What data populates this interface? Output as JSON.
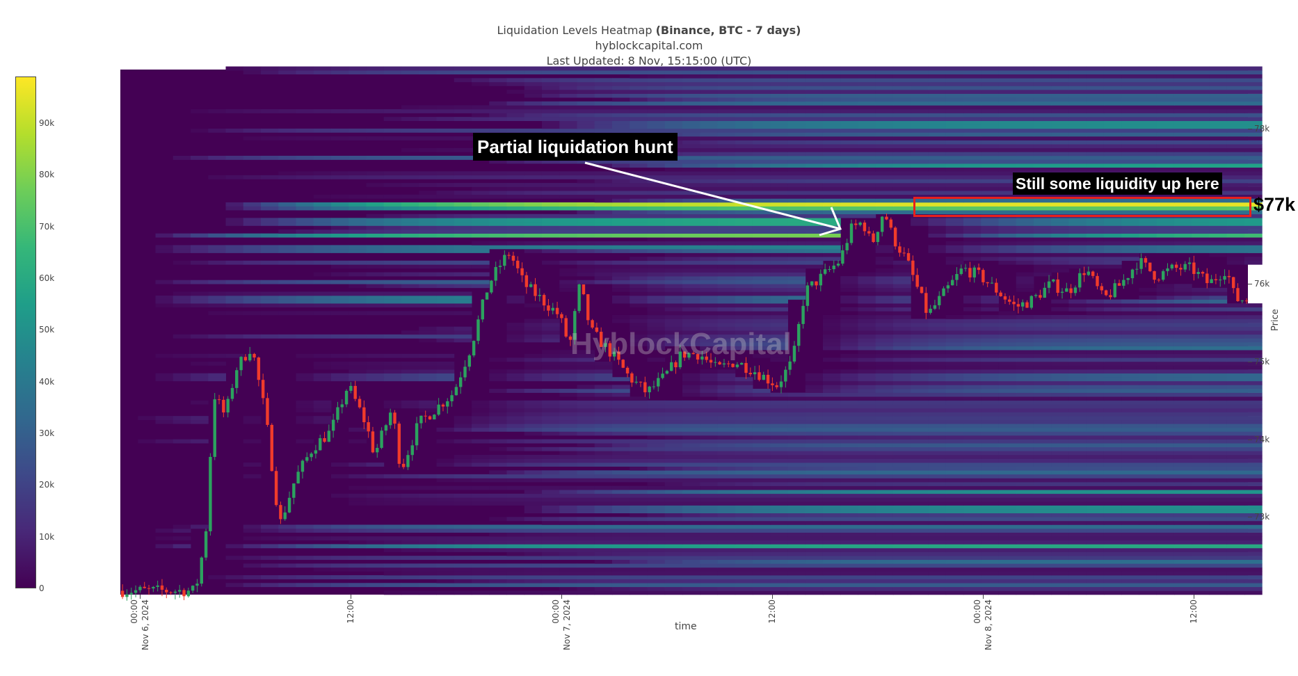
{
  "header": {
    "title_main": "Liquidation Levels Heatmap ",
    "title_bold": "(Binance, BTC - 7 days)",
    "site": "hyblockcapital.com",
    "updated": "Last Updated: 8 Nov, 15:15:00 (UTC)"
  },
  "watermark": "HyblockCapital",
  "annotations": {
    "hunt": "Partial liquidation hunt",
    "liquidity": "Still some liquidity up here",
    "price_label": "$77k"
  },
  "colors": {
    "up": "#2ca25f",
    "down": "#f03b2b",
    "highlight_box": "#e8201c"
  },
  "chart_data": {
    "type": "heatmap",
    "title": "Liquidation Levels Heatmap (Binance, BTC - 7 days)",
    "xlabel": "time",
    "ylabel": "Price",
    "x_unit": "hours since Nov 6, 2024 00:00 UTC",
    "xlim": [
      -1.1,
      63.1
    ],
    "ylim": [
      72000,
      78760
    ],
    "x_ticks": [
      {
        "h": 0,
        "time": "00:00",
        "date": "Nov 6, 2024"
      },
      {
        "h": 12,
        "time": "12:00",
        "date": ""
      },
      {
        "h": 24,
        "time": "00:00",
        "date": "Nov 7, 2024"
      },
      {
        "h": 36,
        "time": "12:00",
        "date": ""
      },
      {
        "h": 48,
        "time": "00:00",
        "date": "Nov 8, 2024"
      },
      {
        "h": 60,
        "time": "12:00",
        "date": ""
      }
    ],
    "y_ticks": [
      {
        "v": 73000,
        "label": "73k"
      },
      {
        "v": 74000,
        "label": "74k"
      },
      {
        "v": 75000,
        "label": "75k"
      },
      {
        "v": 76000,
        "label": "76k"
      },
      {
        "v": 78000,
        "label": "78k"
      }
    ],
    "colorbar": {
      "range": [
        0,
        99000
      ],
      "ticks": [
        {
          "v": 0,
          "label": "0"
        },
        {
          "v": 10000,
          "label": "10k"
        },
        {
          "v": 20000,
          "label": "20k"
        },
        {
          "v": 30000,
          "label": "30k"
        },
        {
          "v": 40000,
          "label": "40k"
        },
        {
          "v": 50000,
          "label": "50k"
        },
        {
          "v": 60000,
          "label": "60k"
        },
        {
          "v": 70000,
          "label": "70k"
        },
        {
          "v": 80000,
          "label": "80k"
        },
        {
          "v": 90000,
          "label": "90k"
        }
      ]
    },
    "price_path": [
      [
        -1.1,
        72050
      ],
      [
        3.3,
        72050
      ],
      [
        3.6,
        72400
      ],
      [
        4,
        73000
      ],
      [
        4.3,
        74600
      ],
      [
        5,
        74300
      ],
      [
        5.6,
        74900
      ],
      [
        6.5,
        75200
      ],
      [
        7.3,
        74300
      ],
      [
        7.8,
        73400
      ],
      [
        8.1,
        72900
      ],
      [
        9,
        73500
      ],
      [
        10,
        73900
      ],
      [
        11,
        74100
      ],
      [
        12,
        74700
      ],
      [
        13,
        74200
      ],
      [
        13.5,
        73800
      ],
      [
        14.5,
        74400
      ],
      [
        15,
        73600
      ],
      [
        16,
        74200
      ],
      [
        16.5,
        74300
      ],
      [
        17.5,
        74500
      ],
      [
        18,
        74600
      ],
      [
        19,
        75200
      ],
      [
        20,
        76000
      ],
      [
        20.8,
        76300
      ],
      [
        21.2,
        76400
      ],
      [
        22,
        76000
      ],
      [
        23,
        75800
      ],
      [
        24,
        75600
      ],
      [
        24.6,
        75200
      ],
      [
        25.2,
        76000
      ],
      [
        25.8,
        75400
      ],
      [
        27,
        75100
      ],
      [
        28,
        74800
      ],
      [
        29,
        74600
      ],
      [
        30,
        74800
      ],
      [
        31,
        75100
      ],
      [
        32,
        75100
      ],
      [
        33,
        74900
      ],
      [
        34,
        75000
      ],
      [
        35,
        74900
      ],
      [
        36.4,
        74700
      ],
      [
        37.3,
        75000
      ],
      [
        38,
        75900
      ],
      [
        39,
        76100
      ],
      [
        40,
        76300
      ],
      [
        40.6,
        76700
      ],
      [
        41.3,
        76800
      ],
      [
        41.8,
        76500
      ],
      [
        42.5,
        76950
      ],
      [
        43,
        76600
      ],
      [
        43.8,
        76300
      ],
      [
        45,
        75600
      ],
      [
        46,
        75900
      ],
      [
        47,
        76200
      ],
      [
        48,
        76100
      ],
      [
        49,
        75900
      ],
      [
        50,
        75700
      ],
      [
        51,
        75800
      ],
      [
        52,
        76000
      ],
      [
        53,
        75900
      ],
      [
        54,
        76200
      ],
      [
        55,
        75800
      ],
      [
        56,
        76000
      ],
      [
        57,
        76300
      ],
      [
        58,
        76100
      ],
      [
        59,
        76200
      ],
      [
        60,
        76200
      ],
      [
        61,
        76000
      ],
      [
        62,
        76200
      ],
      [
        62.5,
        75800
      ],
      [
        63.1,
        75800
      ]
    ],
    "key_levels": [
      {
        "price": 77030,
        "start_h": 4,
        "max": 96000
      },
      {
        "price": 76960,
        "start_h": 4,
        "max": 74000
      },
      {
        "price": 76800,
        "start_h": 4,
        "max": 62000
      },
      {
        "price": 76620,
        "start_h": 0,
        "max": 80000
      },
      {
        "price": 76450,
        "start_h": 0,
        "max": 45000
      },
      {
        "price": 77530,
        "start_h": 25,
        "max": 58000
      },
      {
        "price": 78050,
        "start_h": 22,
        "max": 50000
      },
      {
        "price": 73320,
        "start_h": 21,
        "max": 52000
      },
      {
        "price": 73100,
        "start_h": 21,
        "max": 50000
      },
      {
        "price": 72640,
        "start_h": 0,
        "max": 60000
      },
      {
        "price": 75800,
        "start_h": 0,
        "max": 50000
      },
      {
        "price": 74800,
        "start_h": 0,
        "max": 35000
      }
    ]
  }
}
